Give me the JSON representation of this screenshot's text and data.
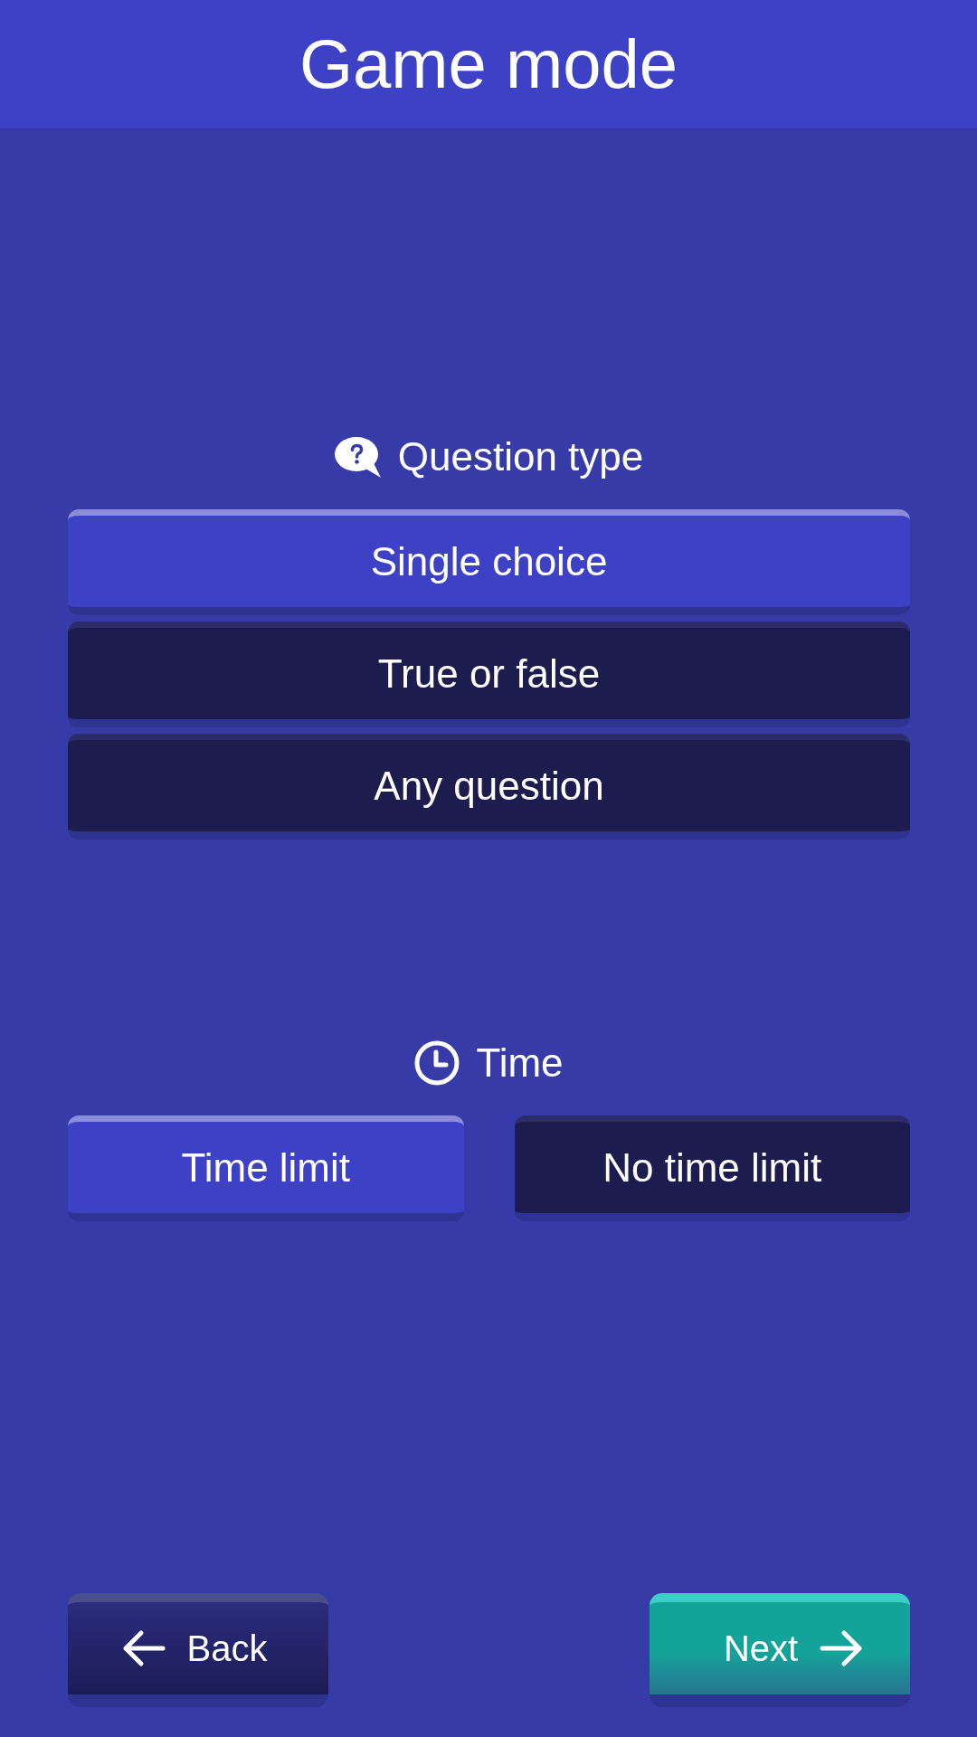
{
  "header": {
    "title": "Game mode"
  },
  "sections": [
    {
      "kind": "question_type",
      "label": "Question type",
      "options": [
        {
          "label": "Single choice",
          "selected": true
        },
        {
          "label": "True or false",
          "selected": false
        },
        {
          "label": "Any question",
          "selected": false
        }
      ]
    },
    {
      "kind": "time",
      "label": "Time",
      "options": [
        {
          "label": "Time limit",
          "selected": true
        },
        {
          "label": "No time limit",
          "selected": false
        }
      ]
    }
  ],
  "footer": {
    "buttons": [
      {
        "kind": "back",
        "label": "Back"
      },
      {
        "kind": "next",
        "label": "Next"
      }
    ]
  }
}
